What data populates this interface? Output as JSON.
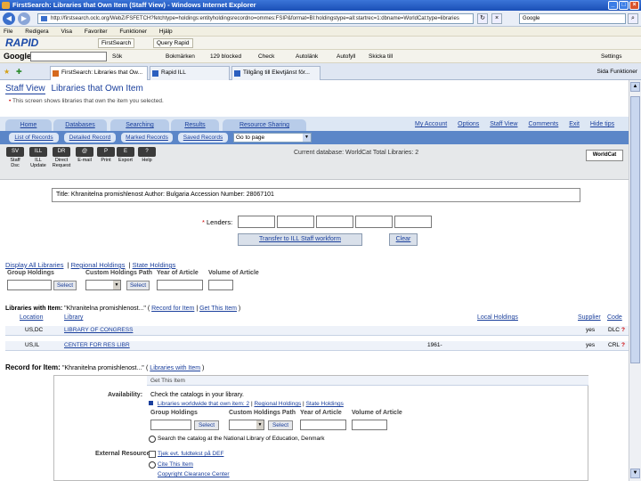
{
  "window": {
    "title": "FirstSearch: Libraries that Own Item (Staff View) - Windows Internet Explorer"
  },
  "address": {
    "url": "http://firstsearch.oclc.org/WebZ/FSFETCH?fetchtype=holdings:entityholdingsrecordno=ommes:FSIP&format=BI:holdingstype=all:startrec=1:dbname=WorldCat:type=libraries",
    "search_placeholder": "Google"
  },
  "menubar": {
    "items": [
      "File",
      "Redigera",
      "Visa",
      "Favoriter",
      "Funktioner",
      "Hjälp"
    ]
  },
  "rapid": {
    "logo": "RAPID",
    "buttons": [
      "FirstSearch",
      "Query Rapid"
    ]
  },
  "googlebar": {
    "logo": "Google",
    "items": [
      "Sök",
      "Bokmärken",
      "129 blocked",
      "Check",
      "Autolänk",
      "Autofyll",
      "Skicka till"
    ],
    "right": "Settings"
  },
  "tabs": {
    "items": [
      "FirstSearch: Libraries that Ow...",
      "Rapid ILL",
      "Tillgång till Elevtjänst för..."
    ],
    "tools": "Sida  Funktioner"
  },
  "page": {
    "staff_view": "Staff View",
    "libraries_title": "Libraries that Own Item",
    "subtitle": "This screen shows libraries that own the item you selected.",
    "nav_tabs": [
      "Home",
      "Databases",
      "Searching",
      "Results",
      "Resource Sharing"
    ],
    "top_links": [
      "My Account",
      "Options",
      "Staff View",
      "Comments",
      "Exit",
      "Hide tips"
    ],
    "sub_tabs": [
      "List of Records",
      "Detailed Record",
      "Marked Records",
      "Saved Records"
    ],
    "go_page": "Go to page",
    "toolbar": [
      {
        "box": "SV",
        "label": "Staff Dsc"
      },
      {
        "box": "ILL",
        "label": "ILL Update"
      },
      {
        "box": "DR",
        "label": "Direct Request"
      },
      {
        "box": "@",
        "label": "E-mail"
      },
      {
        "box": "P",
        "label": "Print"
      },
      {
        "box": "E",
        "label": "Export"
      },
      {
        "box": "?",
        "label": "Help"
      }
    ],
    "current_db": "Current database: WorldCat   Total Libraries: 2",
    "worldcat_logo": "WorldCat",
    "record_line": "Title: Khranitelna promishlenost  Author: Bulgaria  Accession Number: 28067101",
    "lenders_label": "Lenders:",
    "lenders_star": "*",
    "transfer_btn": "Transfer to ILL Staff workform",
    "clear_btn": "Clear",
    "filter_links": [
      "Display All Libraries",
      "Regional Holdings",
      "State Holdings"
    ],
    "filter_sep": "|",
    "group_holdings": "Group Holdings",
    "custom_path": "Custom Holdings Path",
    "year_article": "Year of Article",
    "volume_article": "Volume of Article",
    "select": "Select",
    "libraries_heading_bold": "Libraries with Item:",
    "libraries_heading_title": "\"Khranitelna promishlenost...\"",
    "libraries_heading_links": [
      "Record for Item",
      "Get This Item"
    ],
    "table": {
      "headers": [
        "Location",
        "Library",
        "Local Holdings",
        "Supplier",
        "Code"
      ],
      "rows": [
        {
          "location": "US,DC",
          "library": "LIBRARY OF CONGRESS",
          "holdings": "",
          "supplier": "yes",
          "code": "DLC"
        },
        {
          "location": "US,IL",
          "library": "CENTER FOR RES LIBR",
          "holdings": "1961-",
          "supplier": "yes",
          "code": "CRL"
        }
      ],
      "flag": "?"
    },
    "record_for_item_bold": "Record for Item:",
    "record_for_item_title": "\"Khranitelna promishlenost...\"",
    "record_for_item_link": "Libraries with Item",
    "get_item_header": "Get This Item",
    "availability_label": "Availability:",
    "availability_text": "Check the catalogs in your library.",
    "avail_links": [
      "Libraries worldwide that own item: 2",
      "Regional Holdings",
      "State Holdings"
    ],
    "avail_sep": "|",
    "search_national": "Search the catalog at the National Library of Education, Denmark",
    "external_label": "External Resources:",
    "ext_links": [
      "Tjek evt. fuldtekst på DEF",
      "Cite This Item",
      "Copyright Clearance Center"
    ]
  }
}
